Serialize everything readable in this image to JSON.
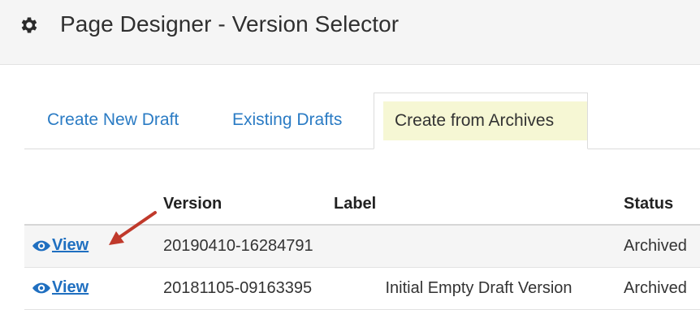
{
  "header": {
    "title": "Page Designer - Version Selector",
    "icon": "gear-icon"
  },
  "tabs": [
    {
      "label": "Create New Draft",
      "active": false
    },
    {
      "label": "Existing Drafts",
      "active": false
    },
    {
      "label": "Create from Archives",
      "active": true
    }
  ],
  "table": {
    "columns": [
      "",
      "Version",
      "Label",
      "Status"
    ],
    "rows": [
      {
        "action": "View",
        "version": "20190410-16284791",
        "label": "",
        "status": "Archived"
      },
      {
        "action": "View",
        "version": "20181105-09163395",
        "label": "Initial Empty Draft Version",
        "status": "Archived"
      }
    ]
  },
  "colors": {
    "link": "#1f6fc0",
    "active_tab_highlight": "#f6f7d4",
    "annotation_arrow": "#c0392b"
  }
}
